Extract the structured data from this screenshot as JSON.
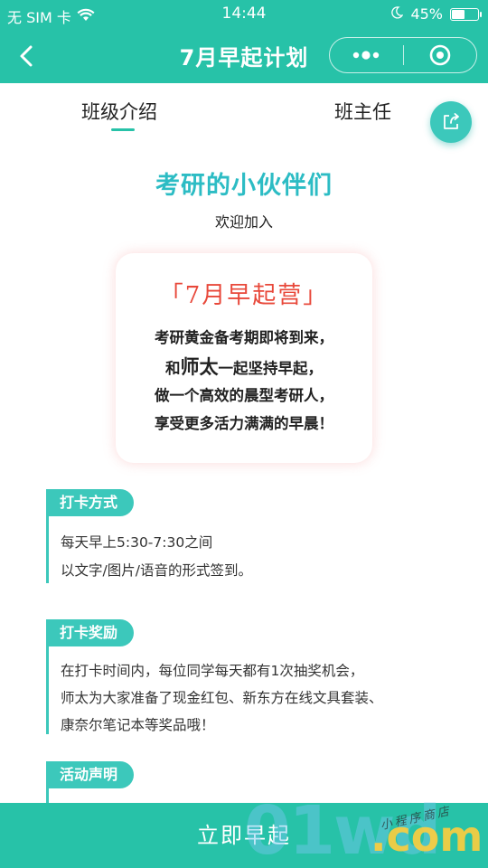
{
  "status_bar": {
    "carrier": "无 SIM 卡",
    "time": "14:44",
    "battery": "45%",
    "battery_level": 0.45
  },
  "nav": {
    "title": "7月早起计划"
  },
  "tabs": [
    {
      "label": "班级介绍",
      "active": true
    },
    {
      "label": "班主任",
      "active": false
    }
  ],
  "intro": {
    "headline": "考研的小伙伴们",
    "subline": "欢迎加入"
  },
  "card": {
    "title": "「7月早起营」",
    "lines": [
      "考研黄金备考期即将到来，",
      "和",
      "师太",
      "一起坚持早起，",
      "做一个高效的晨型考研人，",
      "享受更多活力满满的早晨！"
    ]
  },
  "sections": [
    {
      "tag": "打卡方式",
      "lines": [
        "每天早上5:30-7:30之间",
        "以文字/图片/语音的形式签到。"
      ]
    },
    {
      "tag": "打卡奖励",
      "lines": [
        "在打卡时间内，每位同学每天都有1次抽奖机会，",
        "师太为大家准备了现金红包、新东方在线文具套装、",
        "康奈尔笔记本等奖品哦！"
      ]
    },
    {
      "tag": "活动声明",
      "lines": []
    }
  ],
  "bottom_button": {
    "label": "立即早起"
  },
  "watermark": {
    "big": "01wd",
    "com": ".com",
    "script": "小程序商店"
  },
  "colors": {
    "primary": "#27c2a8",
    "accent_teal": "#3cc8bb",
    "headline": "#2cbcc4",
    "card_title": "#e8483a"
  }
}
